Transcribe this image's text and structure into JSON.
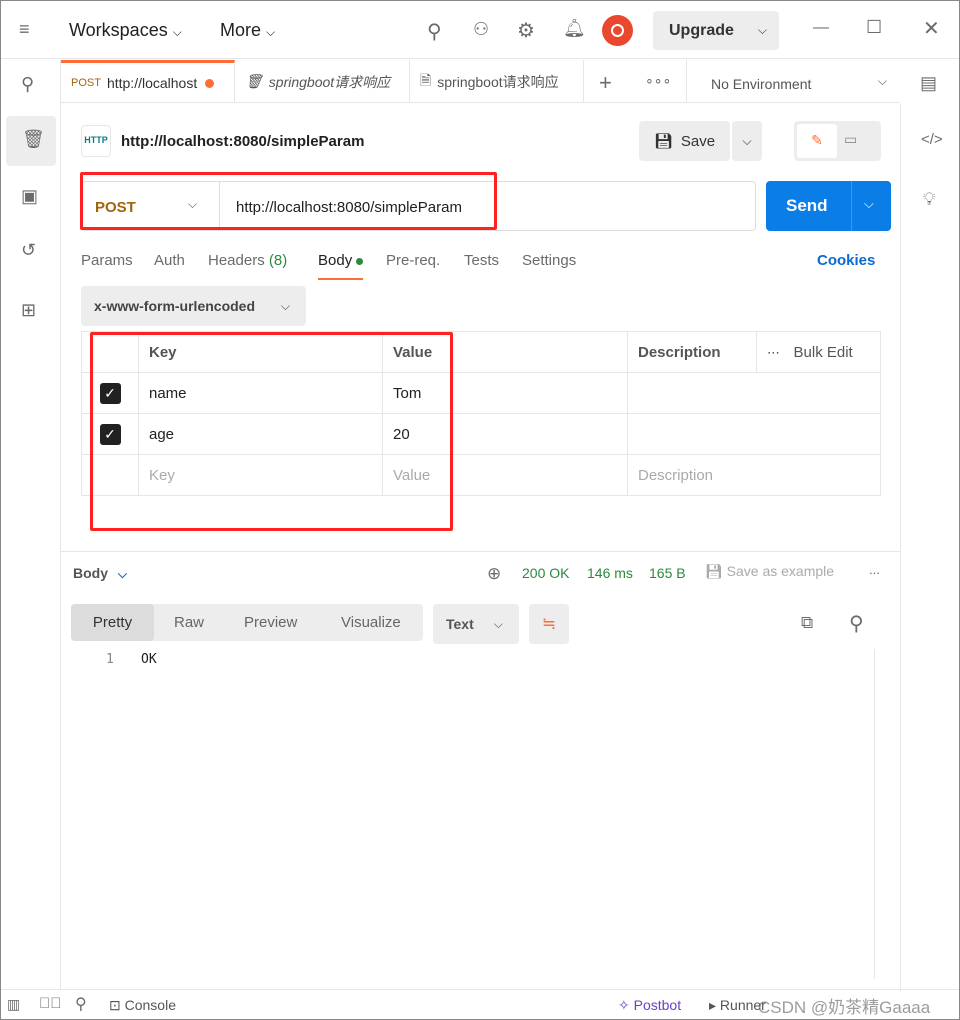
{
  "topbar": {
    "workspaces": "Workspaces",
    "more": "More",
    "upgrade": "Upgrade"
  },
  "tabs": [
    {
      "method": "POST",
      "label": "http://localhost"
    },
    {
      "label": "springboot请求响应"
    },
    {
      "label": "springboot请求响应"
    }
  ],
  "environment": "No Environment",
  "request": {
    "title": "http://localhost:8080/simpleParam",
    "save": "Save",
    "method": "POST",
    "url": "http://localhost:8080/simpleParam",
    "send": "Send"
  },
  "subtabs": {
    "params": "Params",
    "auth": "Auth",
    "headers": "Headers",
    "headers_count": "(8)",
    "body": "Body",
    "prereq": "Pre-req.",
    "tests": "Tests",
    "settings": "Settings",
    "cookies": "Cookies"
  },
  "body_type": "x-www-form-urlencoded",
  "table": {
    "headers": {
      "key": "Key",
      "value": "Value",
      "description": "Description",
      "bulk": "Bulk Edit"
    },
    "rows": [
      {
        "key": "name",
        "value": "Tom"
      },
      {
        "key": "age",
        "value": "20"
      }
    ],
    "placeholders": {
      "key": "Key",
      "value": "Value",
      "description": "Description"
    }
  },
  "response": {
    "label": "Body",
    "status": "200 OK",
    "time": "146 ms",
    "size": "165 B",
    "save_example": "Save as example",
    "views": [
      "Pretty",
      "Raw",
      "Preview",
      "Visualize"
    ],
    "format": "Text",
    "line_no": "1",
    "content": "OK"
  },
  "statusbar": {
    "console": "Console",
    "postbot": "Postbot",
    "runner": "Runner",
    "watermark": "CSDN @奶茶精Gaaaa"
  },
  "colors": {
    "accent": "#ff6c37",
    "send": "#0b7de7",
    "post": "#a5620b",
    "ok": "#2b8a3e",
    "cookies": "#0b6ad4"
  }
}
